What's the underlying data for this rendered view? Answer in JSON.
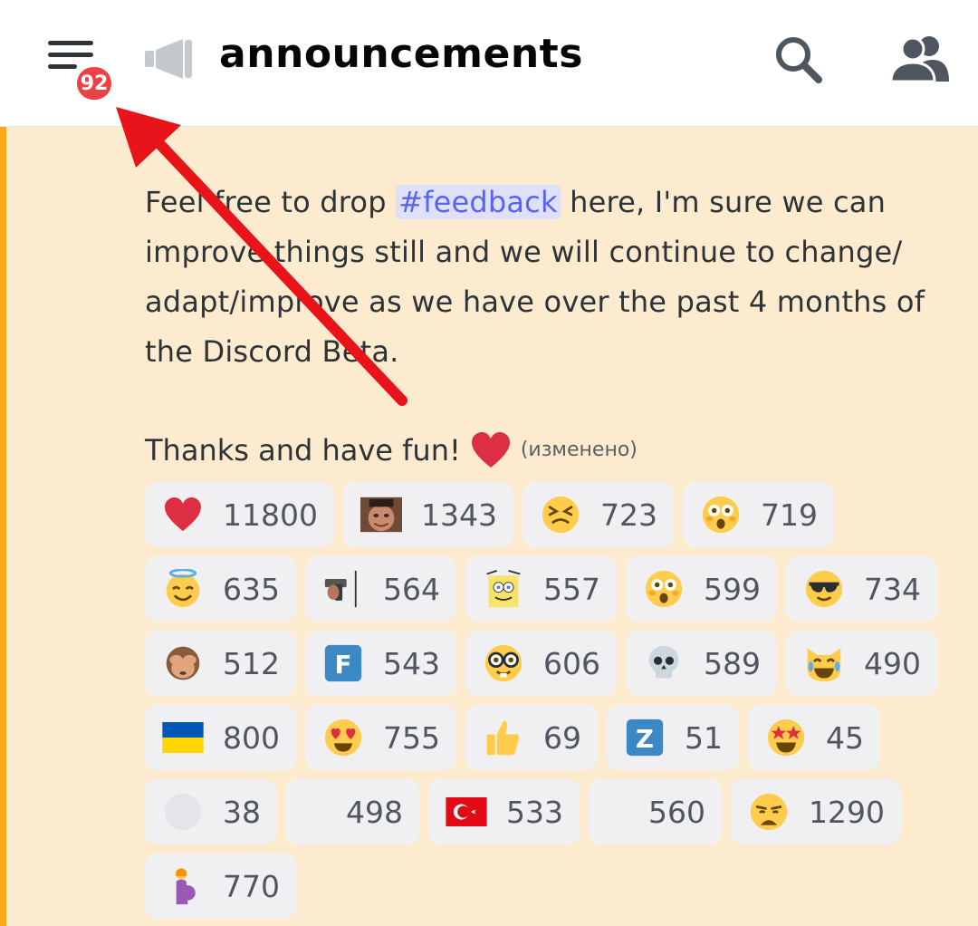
{
  "header": {
    "channel_name": "announcements",
    "unread_badge": "92",
    "icons": [
      "menu-icon",
      "megaphone-icon",
      "search-icon",
      "members-icon"
    ]
  },
  "message": {
    "text_before": "Feel free to drop ",
    "mention": "#feedback",
    "text_after": " here, I'm sure we can improve things still and we will continue to change/ adapt/improve as we have over the past 4 months of the Discord Beta.",
    "thanks": "Thanks and have fun!",
    "edited": "(изменено)"
  },
  "colors": {
    "accent_bar": "#faa81a",
    "badge": "#ed4245",
    "mention_bg": "#dee0fc",
    "mention_text": "#5865f2",
    "highlight_bg": "#fdebcf",
    "annotation_arrow": "#e8141a"
  },
  "reactions": [
    {
      "emoji": "heart",
      "count": "11800"
    },
    {
      "emoji": "custom-man-face",
      "count": "1343"
    },
    {
      "emoji": "tired-face",
      "count": "723"
    },
    {
      "emoji": "flushed-face",
      "count": "719"
    },
    {
      "emoji": "halo-face",
      "count": "635"
    },
    {
      "emoji": "custom-pistol",
      "count": "564"
    },
    {
      "emoji": "custom-spongebob",
      "count": "557"
    },
    {
      "emoji": "flushed-face",
      "count": "599"
    },
    {
      "emoji": "sunglasses-face",
      "count": "734"
    },
    {
      "emoji": "see-no-evil-monkey",
      "count": "512"
    },
    {
      "emoji": "regional-f",
      "count": "543"
    },
    {
      "emoji": "nerd-face",
      "count": "606"
    },
    {
      "emoji": "skull",
      "count": "589"
    },
    {
      "emoji": "joy-cat",
      "count": "490"
    },
    {
      "emoji": "flag-ukraine",
      "count": "800"
    },
    {
      "emoji": "heart-eyes",
      "count": "755"
    },
    {
      "emoji": "thumbs-up",
      "count": "69"
    },
    {
      "emoji": "regional-z",
      "count": "51"
    },
    {
      "emoji": "star-struck",
      "count": "45"
    },
    {
      "emoji": "blank-circle",
      "count": "38"
    },
    {
      "emoji": "none",
      "count": "498"
    },
    {
      "emoji": "flag-turkey",
      "count": "533"
    },
    {
      "emoji": "none",
      "count": "560"
    },
    {
      "emoji": "weary-face",
      "count": "1290"
    },
    {
      "emoji": "pregnant-woman",
      "count": "770"
    }
  ]
}
